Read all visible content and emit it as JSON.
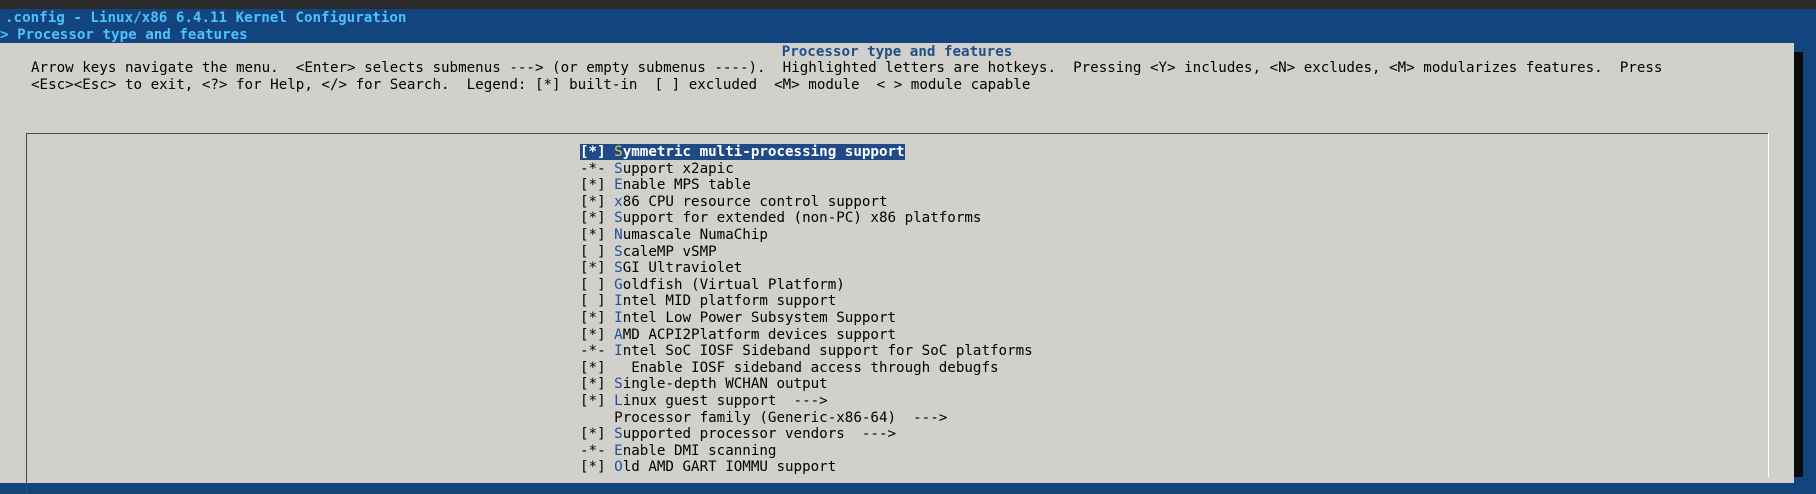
{
  "window": {
    "title": ".config - Linux/x86 6.4.11 Kernel Configuration",
    "breadcrumb": "> Processor type and features"
  },
  "dialog": {
    "title": "Processor type and features",
    "help_line1": "Arrow keys navigate the menu.  <Enter> selects submenus ---> (or empty submenus ----).  Highlighted letters are hotkeys.  Pressing <Y> includes, <N> excludes, <M> modularizes features.  Press",
    "help_line2": "<Esc><Esc> to exit, <?> for Help, </> for Search.  Legend: [*] built-in  [ ] excluded  <M> module  < > module capable"
  },
  "menu": {
    "selected_index": 0,
    "items": [
      {
        "state": "[*]",
        "hot": "S",
        "rest": "ymmetric multi-processing support"
      },
      {
        "state": "-*-",
        "hot": "S",
        "rest": "upport x2apic"
      },
      {
        "state": "[*]",
        "hot": "E",
        "rest": "nable MPS table"
      },
      {
        "state": "[*]",
        "hot": "x",
        "rest": "86 CPU resource control support"
      },
      {
        "state": "[*]",
        "hot": "S",
        "rest": "upport for extended (non-PC) x86 platforms"
      },
      {
        "state": "[*]",
        "hot": "N",
        "rest": "umascale NumaChip"
      },
      {
        "state": "[ ]",
        "hot": "S",
        "rest": "caleMP vSMP"
      },
      {
        "state": "[*]",
        "hot": "S",
        "rest": "GI Ultraviolet"
      },
      {
        "state": "[ ]",
        "hot": "G",
        "rest": "oldfish (Virtual Platform)"
      },
      {
        "state": "[ ]",
        "hot": "I",
        "rest": "ntel MID platform support"
      },
      {
        "state": "[*]",
        "hot": "I",
        "rest": "ntel Low Power Subsystem Support"
      },
      {
        "state": "[*]",
        "hot": "A",
        "rest": "MD ACPI2Platform devices support"
      },
      {
        "state": "-*-",
        "hot": "I",
        "rest": "ntel SoC IOSF Sideband support for SoC platforms"
      },
      {
        "state": "[*]",
        "hot": "",
        "rest": "  Enable IOSF sideband access through debugfs"
      },
      {
        "state": "[*]",
        "hot": "S",
        "rest": "ingle-depth WCHAN output"
      },
      {
        "state": "[*]",
        "hot": "L",
        "rest": "inux guest support  --->"
      },
      {
        "state": "   ",
        "hot": "",
        "rest": "Processor family (Generic-x86-64)  --->"
      },
      {
        "state": "[*]",
        "hot": "S",
        "rest": "upported processor vendors  --->"
      },
      {
        "state": "-*-",
        "hot": "E",
        "rest": "nable DMI scanning"
      },
      {
        "state": "[*]",
        "hot": "O",
        "rest": "ld AMD GART IOMMU support"
      }
    ]
  },
  "colors": {
    "background": "#12447e",
    "dialog": "#d2d0cb",
    "selection": "#1f4a86",
    "hotkey": "#1f4fa0"
  }
}
